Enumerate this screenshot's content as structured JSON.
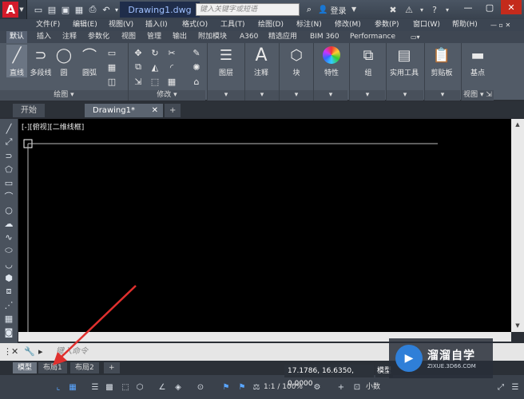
{
  "title_bar": {
    "doc_title": "Drawing1.dwg",
    "search_placeholder": "键入关键字或短语",
    "login": "登录"
  },
  "menu": [
    "文件(F)",
    "编辑(E)",
    "视图(V)",
    "插入(I)",
    "格式(O)",
    "工具(T)",
    "绘图(D)",
    "标注(N)",
    "修改(M)",
    "参数(P)",
    "窗口(W)",
    "帮助(H)"
  ],
  "ribbon_tabs": [
    "默认",
    "插入",
    "注释",
    "参数化",
    "视图",
    "管理",
    "输出",
    "附加模块",
    "A360",
    "精选应用",
    "BIM 360",
    "Performance"
  ],
  "ribbon": {
    "draw_tools": [
      "直线",
      "多段线",
      "圆",
      "圆弧"
    ],
    "draw_panel": "绘图",
    "modify_panel": "修改",
    "layers": "图层",
    "annotation": "注释",
    "block": "块",
    "properties": "特性",
    "group": "组",
    "utilities": "实用工具",
    "clipboard": "剪贴板",
    "base": "基点",
    "view": "视图"
  },
  "doc_tabs": [
    "开始",
    "Drawing1*"
  ],
  "viewport_label": "[-][俯视][二维线框]",
  "command_placeholder": "键入命令",
  "layout_tabs": [
    "模型",
    "布局1",
    "布局2"
  ],
  "status": {
    "coords": "17.1786, 16.6350, 0.0000",
    "model": "模型",
    "scale": "1:1 / 100%",
    "units": "小数"
  },
  "watermark": {
    "name": "溜溜自学",
    "url": "ZIXUE.3D66.COM"
  },
  "colors": {
    "accent_red": "#d31b2a",
    "annotation_arrow": "#e0302e",
    "canvas": "#000000"
  }
}
